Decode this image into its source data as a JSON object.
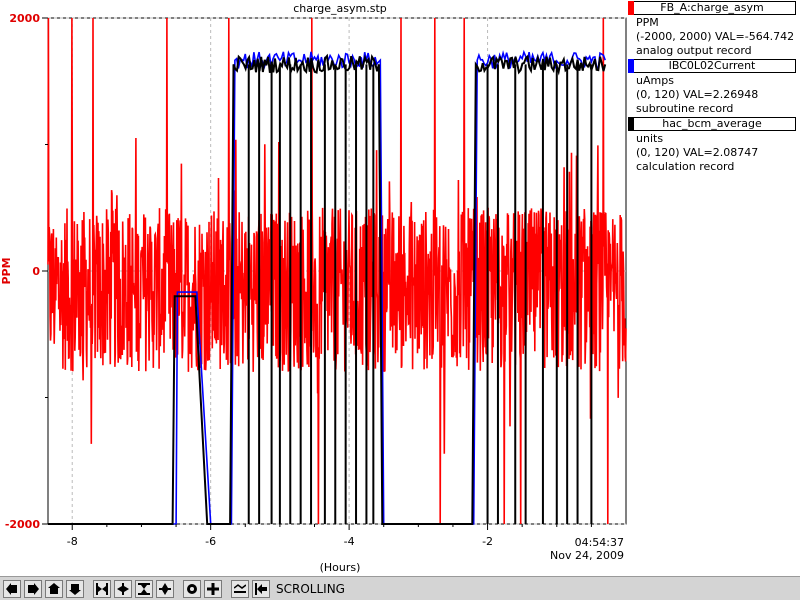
{
  "chart_data": {
    "type": "line",
    "title": "charge_asym.stp",
    "xlabel": "(Hours)",
    "ylabel": "PPM",
    "x_range": [
      -8.35,
      0
    ],
    "y_range": [
      -2000,
      2000
    ],
    "x_ticks": [
      -8,
      -6,
      -4,
      -2
    ],
    "x_tick_labels": [
      "-8",
      "-6",
      "-4",
      "-2"
    ],
    "y_ticks": [
      2000,
      0,
      -2000
    ],
    "y_tick_labels": [
      "2000",
      "0",
      "-2000"
    ],
    "end_time": "04:54:37",
    "end_date": "Nov 24, 2009",
    "grid": true,
    "series": [
      {
        "name": "FB_A:charge_asym",
        "color": "#ff0000",
        "y_range": [
          -2000,
          2000
        ],
        "summary": "noisy trace centred near -150 PPM with bursts reaching +/-2000"
      },
      {
        "name": "IBC0L02Current",
        "color": "#0000ff",
        "y_range": [
          0,
          120
        ],
        "segments": [
          [
            -8.35,
            0
          ],
          [
            -6.5,
            0
          ],
          [
            -6.48,
            55
          ],
          [
            -6.2,
            55
          ],
          [
            -6.0,
            0
          ],
          [
            -5.7,
            0
          ],
          [
            -5.65,
            110
          ],
          [
            -3.55,
            110
          ],
          [
            -3.5,
            0
          ],
          [
            -2.2,
            0
          ],
          [
            -2.15,
            110
          ],
          [
            -0.3,
            110
          ]
        ]
      },
      {
        "name": "hac_bcm_average",
        "color": "#000000",
        "y_range": [
          0,
          120
        ],
        "segments": [
          [
            -8.35,
            0
          ],
          [
            -6.55,
            0
          ],
          [
            -6.52,
            54
          ],
          [
            -6.22,
            54
          ],
          [
            -6.05,
            0
          ],
          [
            -5.72,
            0
          ],
          [
            -5.67,
            109
          ],
          [
            -3.57,
            109
          ],
          [
            -3.52,
            0
          ],
          [
            -2.22,
            0
          ],
          [
            -2.17,
            109
          ],
          [
            -0.3,
            109
          ]
        ]
      }
    ]
  },
  "legend": [
    {
      "name": "FB_A:charge_asym",
      "color": "#ff0000",
      "units": "PPM",
      "range_val": "(-2000, 2000) VAL=-564.742",
      "record": "analog output record"
    },
    {
      "name": "IBC0L02Current",
      "color": "#0000ff",
      "units": "uAmps",
      "range_val": "(0, 120) VAL=2.26948",
      "record": "subroutine record"
    },
    {
      "name": "hac_bcm_average",
      "color": "#000000",
      "units": "units",
      "range_val": "(0, 120) VAL=2.08747",
      "record": "calculation record"
    }
  ],
  "toolbar": {
    "buttons": [
      "pan-left-icon",
      "pan-right-icon",
      "pan-up-icon",
      "pan-down-icon",
      "zoom-in-x-icon",
      "zoom-out-x-icon",
      "zoom-in-y-icon",
      "zoom-out-y-icon",
      "autoscale-icon",
      "reset-icon",
      "undo-icon",
      "scroll-icon"
    ],
    "status": "SCROLLING"
  }
}
